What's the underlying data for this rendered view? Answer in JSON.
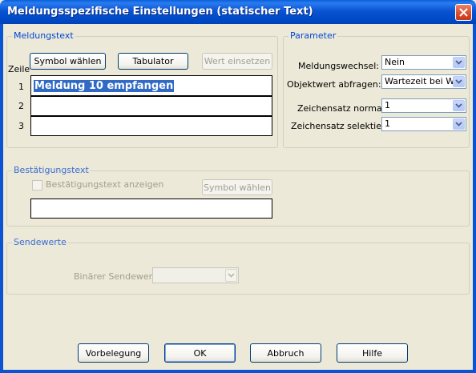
{
  "window": {
    "title": "Meldungsspezifische Einstellungen (statischer Text)"
  },
  "meldungstext": {
    "group_label": "Meldungstext",
    "zeile_label": "Zeile",
    "symbol_button": "Symbol wählen",
    "tabulator_button": "Tabulator",
    "wert_button": "Wert einsetzen",
    "lines": [
      {
        "num": "1",
        "value": "Meldung 10 empfangen"
      },
      {
        "num": "2",
        "value": ""
      },
      {
        "num": "3",
        "value": ""
      }
    ]
  },
  "parameter": {
    "group_label": "Parameter",
    "meldungswechsel_label": "Meldungswechsel:",
    "meldungswechsel_value": "Nein",
    "objektwert_label": "Objektwert abfragen:",
    "objektwert_value": "Wartezeit bei Wi",
    "zeichensatz_normal_label": "Zeichensatz normal:",
    "zeichensatz_normal_value": "1",
    "zeichensatz_selektiert_label": "Zeichensatz selektiert:",
    "zeichensatz_selektiert_value": "1"
  },
  "bestaetigung": {
    "group_label": "Bestätigungstext",
    "checkbox_label": "Bestätigungstext anzeigen",
    "symbol_button": "Symbol wählen",
    "text_value": ""
  },
  "sendewerte": {
    "group_label": "Sendewerte",
    "binaer_label": "Binärer Sendewert:",
    "binaer_value": ""
  },
  "footer": {
    "vorbelegung": "Vorbelegung",
    "ok": "OK",
    "abbruch": "Abbruch",
    "hilfe": "Hilfe"
  },
  "colors": {
    "titlebar": "#0a54d4",
    "accent_label": "#0046d5",
    "selection": "#316ac5",
    "close": "#d94b2a"
  }
}
